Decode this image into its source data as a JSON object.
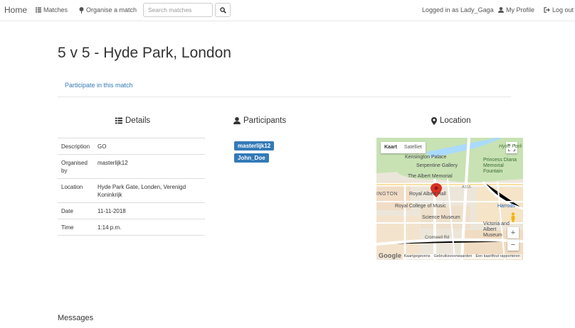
{
  "navbar": {
    "brand": "Home",
    "matches": "Matches",
    "organise": "Organise a match",
    "search_placeholder": "Search matches",
    "logged_in": "Logged in as Lady_Gaga",
    "profile": "My Profile",
    "logout": "Log out"
  },
  "match": {
    "title": "5 v 5 - Hyde Park, London",
    "participate": "Participate in this match"
  },
  "details": {
    "heading": "Details",
    "rows": [
      {
        "key": "Description",
        "value": "GO"
      },
      {
        "key": "Organised by",
        "value": "masterlijk12"
      },
      {
        "key": "Location",
        "value": "Hyde Park Gate, Londen, Verenigd Koninkrijk"
      },
      {
        "key": "Date",
        "value": "11-11-2018"
      },
      {
        "key": "Time",
        "value": "1:14 p.m."
      }
    ]
  },
  "participants": {
    "heading": "Participants",
    "list": [
      "masterlijk12",
      "John_Doe"
    ]
  },
  "location": {
    "heading": "Location",
    "map": {
      "type_map": "Kaart",
      "type_satellite": "Satelliet",
      "labels": {
        "hyde_park": "Hyde Park",
        "kensington_palace": "Kensington Palace",
        "serpentine": "Serpentine Gallery",
        "albert_memorial": "The Albert Memorial",
        "princess_diana": "Princess Diana Memorial Fountain",
        "royal_albert_hall": "Royal Albert Hall",
        "kensington": "INGTON",
        "a315": "A315",
        "royal_college": "Royal College of Music",
        "harrods": "Harrods",
        "science_museum": "Science Museum",
        "va": "Victoria and Albert Museum",
        "cromwell": "Cromwell Rd"
      },
      "zoom_in": "+",
      "zoom_out": "−",
      "google": "Google",
      "attr_data": "Kaartgegevens",
      "attr_terms": "Gebruiksvoorwaarden",
      "attr_report": "Een kaartfout rapporteren"
    }
  },
  "messages": {
    "heading": "Messages"
  },
  "colors": {
    "link": "#337ab7",
    "badge": "#337ab7",
    "map_marker": "#d93025"
  }
}
